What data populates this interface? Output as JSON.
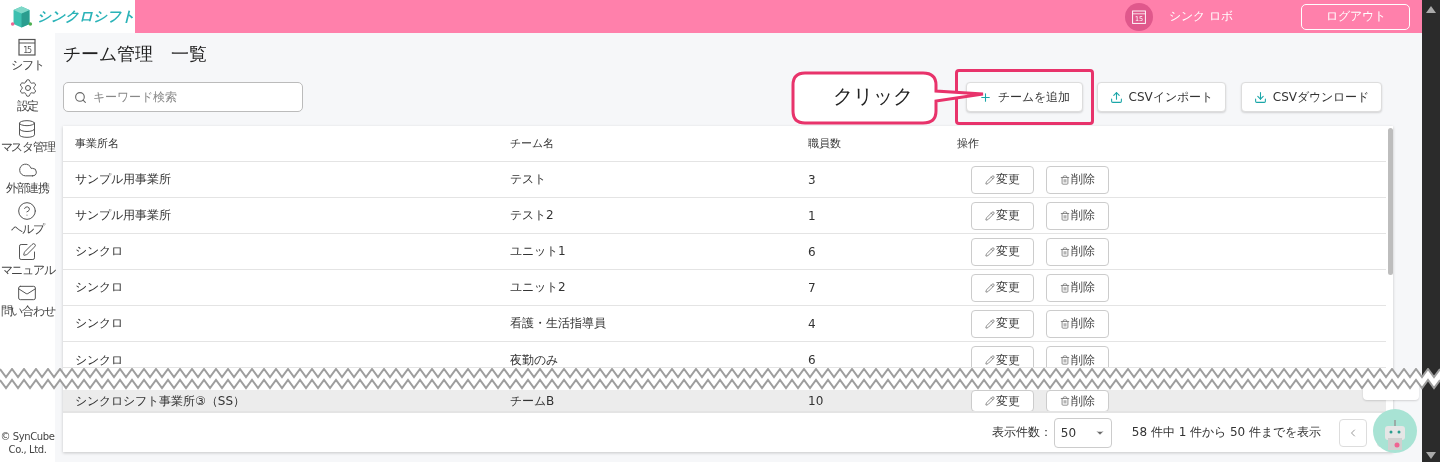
{
  "header": {
    "app_name": "シンクロシフト",
    "calendar_day": "15",
    "user_name": "シンク ロボ",
    "logout": "ログアウト"
  },
  "sidebar": {
    "items": [
      {
        "kind": "calendar",
        "label": "シフト",
        "day": "15"
      },
      {
        "kind": "settings",
        "label": "設定"
      },
      {
        "kind": "database",
        "label": "マスタ管理"
      },
      {
        "kind": "cloud",
        "label": "外部連携"
      },
      {
        "kind": "help",
        "label": "ヘルプ"
      },
      {
        "kind": "manual",
        "label": "マニュアル"
      },
      {
        "kind": "mail",
        "label": "問い合わせ"
      }
    ],
    "copyright": [
      "© SynCube",
      "Co., Ltd."
    ]
  },
  "page_title": "チーム管理　一覧",
  "search": {
    "placeholder": "キーワード検索"
  },
  "toolbar_buttons": [
    {
      "kind": "add",
      "label": "チームを追加",
      "highlighted": true
    },
    {
      "kind": "upload",
      "label": "CSVインポート",
      "highlighted": false
    },
    {
      "kind": "download",
      "label": "CSVダウンロード",
      "highlighted": false
    }
  ],
  "callout": "クリック",
  "table": {
    "columns": [
      "事業所名",
      "チーム名",
      "職員数",
      "操作"
    ],
    "rows": [
      {
        "office": "サンプル用事業所",
        "team": "テスト",
        "staff": "3",
        "actions": [
          "変更",
          "削除"
        ],
        "hovered": false,
        "cut": false
      },
      {
        "office": "サンプル用事業所",
        "team": "テスト2",
        "staff": "1",
        "actions": [
          "変更",
          "削除"
        ],
        "hovered": false,
        "cut": false
      },
      {
        "office": "シンクロ",
        "team": "ユニット1",
        "staff": "6",
        "actions": [
          "変更",
          "削除"
        ],
        "hovered": false,
        "cut": false
      },
      {
        "office": "シンクロ",
        "team": "ユニット2",
        "staff": "7",
        "actions": [
          "変更",
          "削除"
        ],
        "hovered": false,
        "cut": false
      },
      {
        "office": "シンクロ",
        "team": "看護・生活指導員",
        "staff": "4",
        "actions": [
          "変更",
          "削除"
        ],
        "hovered": false,
        "cut": false
      },
      {
        "office": "シンクロ",
        "team": "夜勤のみ",
        "staff": "6",
        "actions": [
          "変更",
          "削除"
        ],
        "hovered": false,
        "cut_bottom": true,
        "cut": false
      },
      {
        "office": "シンクロシフト事業所③（SS）",
        "team": "チームB",
        "staff": "10",
        "actions": [
          "変更",
          "削除"
        ],
        "hovered": true,
        "cut": true
      }
    ]
  },
  "pager": {
    "per_page_label": "表示件数：",
    "per_page": "50",
    "summary": "58 件中 1 件から 50 件までを表示"
  }
}
